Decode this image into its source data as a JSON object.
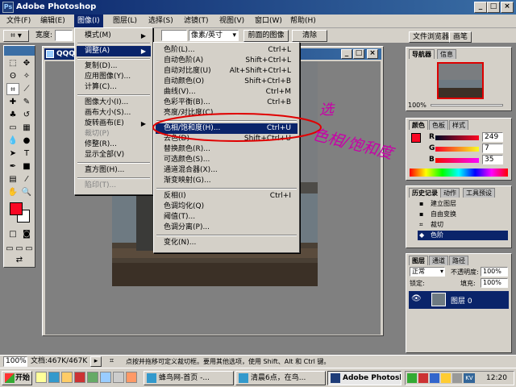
{
  "window": {
    "title": "Adobe Photoshop"
  },
  "caption_buttons": {
    "min": "_",
    "max": "□",
    "close": "×"
  },
  "menubar": {
    "items": [
      "文件(F)",
      "编辑(E)",
      "图像(I)",
      "图层(L)",
      "选择(S)",
      "滤镜(T)",
      "视图(V)",
      "窗口(W)",
      "帮助(H)"
    ],
    "active_index": 2
  },
  "options": {
    "width_label": "宽度:",
    "unit_value": "像素/英寸",
    "front_image_button": "前面的图像",
    "clear_button": "清除",
    "well_tabs": [
      "文件浏览器",
      "画笔"
    ]
  },
  "document": {
    "title": "QQQQ"
  },
  "image_menu": {
    "items": [
      {
        "label": "模式(M)",
        "submenu": true
      },
      {
        "sep": true
      },
      {
        "label": "调整(A)",
        "submenu": true,
        "highlighted": true
      },
      {
        "sep": true
      },
      {
        "label": "复制(D)..."
      },
      {
        "label": "应用图像(Y)..."
      },
      {
        "label": "计算(C)..."
      },
      {
        "sep": true
      },
      {
        "label": "图像大小(I)..."
      },
      {
        "label": "画布大小(S)..."
      },
      {
        "label": "旋转画布(E)",
        "submenu": true
      },
      {
        "label": "裁切(P)",
        "disabled": true
      },
      {
        "label": "修整(R)..."
      },
      {
        "label": "显示全部(V)"
      },
      {
        "sep": true
      },
      {
        "label": "直方图(H)..."
      },
      {
        "sep": true
      },
      {
        "label": "陷印(T)...",
        "disabled": true
      }
    ]
  },
  "adjust_menu": {
    "items": [
      {
        "label": "色阶(L)...",
        "shortcut": "Ctrl+L"
      },
      {
        "label": "自动色阶(A)",
        "shortcut": "Shift+Ctrl+L"
      },
      {
        "label": "自动对比度(U)",
        "shortcut": "Alt+Shift+Ctrl+L"
      },
      {
        "label": "自动颜色(O)",
        "shortcut": "Shift+Ctrl+B"
      },
      {
        "label": "曲线(V)...",
        "shortcut": "Ctrl+M"
      },
      {
        "label": "色彩平衡(B)...",
        "shortcut": "Ctrl+B"
      },
      {
        "label": "亮度/对比度(C)...",
        "shortcut": ""
      },
      {
        "sep": true
      },
      {
        "label": "色相/饱和度(H)...",
        "shortcut": "Ctrl+U",
        "highlighted": true
      },
      {
        "label": "去色(D)",
        "shortcut": "Shift+Ctrl+U"
      },
      {
        "label": "替换颜色(R)...",
        "shortcut": ""
      },
      {
        "label": "可选颜色(S)...",
        "shortcut": ""
      },
      {
        "label": "通道混合器(X)...",
        "shortcut": ""
      },
      {
        "label": "渐变映射(G)...",
        "shortcut": ""
      },
      {
        "sep": true
      },
      {
        "label": "反相(I)",
        "shortcut": "Ctrl+I"
      },
      {
        "label": "色调均化(Q)",
        "shortcut": ""
      },
      {
        "label": "阈值(T)...",
        "shortcut": ""
      },
      {
        "label": "色调分离(P)...",
        "shortcut": ""
      },
      {
        "sep": true
      },
      {
        "label": "变化(N)...",
        "shortcut": ""
      }
    ]
  },
  "annotation": {
    "line1": "选",
    "line2": "色相/饱和度"
  },
  "navigator": {
    "tabs": [
      "导航器",
      "信息"
    ],
    "zoom": "100%"
  },
  "color_palette": {
    "tabs": [
      "颜色",
      "色板",
      "样式"
    ],
    "channels": [
      {
        "label": "R",
        "value": "249"
      },
      {
        "label": "G",
        "value": "7"
      },
      {
        "label": "B",
        "value": "35"
      }
    ],
    "foreground": "#f90723"
  },
  "history": {
    "tabs": [
      "历史记录",
      "动作",
      "工具预设"
    ],
    "items": [
      "建立图层",
      "自由变换",
      "裁切",
      "色阶"
    ]
  },
  "layers": {
    "tabs": [
      "图层",
      "通道",
      "路径"
    ],
    "blend_mode": "正常",
    "opacity_label": "不透明度:",
    "opacity": "100%",
    "lock_label": "锁定:",
    "fill_label": "填充:",
    "fill": "100%",
    "layer_name": "图层 0"
  },
  "status": {
    "zoom": "100%",
    "doc_info": "文档:467K/467K",
    "hint": "点按并拖移可定义裁切框。要用其他选项，使用 Shift、Alt 和 Ctrl 键。"
  },
  "taskbar": {
    "start": "开始",
    "tasks": [
      "蜂鸟网-首页 -...",
      "清晨6点，在鸟...",
      "Adobe Photoshop"
    ],
    "active_index": 2,
    "clock": "12:20",
    "tray_text": "KV"
  },
  "colors": {
    "accent": "#0a246a",
    "face": "#d4d0c8",
    "annotation": "#c800a8"
  }
}
